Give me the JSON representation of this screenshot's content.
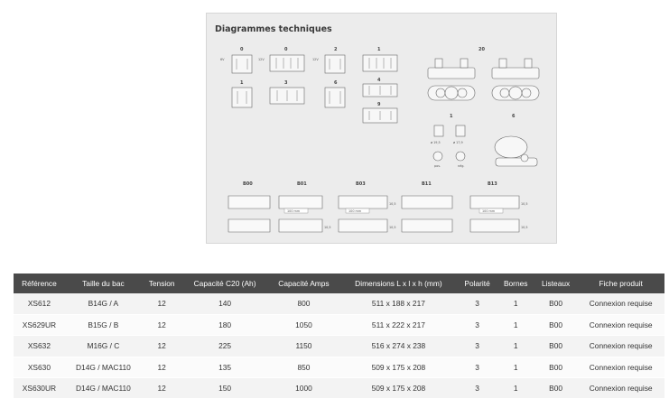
{
  "diagrams": {
    "title": "Diagrammes techniques",
    "terminal_codes": [
      "0",
      "0",
      "2",
      "1",
      "1",
      "3",
      "6",
      "4",
      "9"
    ],
    "voltages": [
      "6V",
      "12V",
      "12V"
    ],
    "terminal_type_codes": [
      "20",
      "1",
      "6"
    ],
    "terminal_notes": [
      "ø 19,5",
      "ø 17,9",
      "pos.",
      "nég."
    ],
    "hold_down_codes": [
      "B00",
      "B01",
      "B03",
      "B11",
      "B13"
    ],
    "dimension_notes": [
      "100 mm",
      "100 mm",
      "100 mm",
      "10,5",
      "10,5",
      "10,5",
      "10,5",
      "10,5"
    ]
  },
  "table": {
    "headers": [
      "Référence",
      "Taille du bac",
      "Tension",
      "Capacité C20 (Ah)",
      "Capacité Amps",
      "Dimensions L x l x h (mm)",
      "Polarité",
      "Bornes",
      "Listeaux",
      "Fiche produit"
    ],
    "rows": [
      [
        "XS612",
        "B14G / A",
        "12",
        "140",
        "800",
        "511 x 188 x 217",
        "3",
        "1",
        "B00",
        "Connexion requise"
      ],
      [
        "XS629UR",
        "B15G / B",
        "12",
        "180",
        "1050",
        "511 x 222 x 217",
        "3",
        "1",
        "B00",
        "Connexion requise"
      ],
      [
        "XS632",
        "M16G / C",
        "12",
        "225",
        "1150",
        "516 x 274 x 238",
        "3",
        "1",
        "B00",
        "Connexion requise"
      ],
      [
        "XS630",
        "D14G / MAC110",
        "12",
        "135",
        "850",
        "509 x 175 x 208",
        "3",
        "1",
        "B00",
        "Connexion requise"
      ],
      [
        "XS630UR",
        "D14G / MAC110",
        "12",
        "150",
        "1000",
        "509 x 175 x 208",
        "3",
        "1",
        "B00",
        "Connexion requise"
      ]
    ]
  }
}
